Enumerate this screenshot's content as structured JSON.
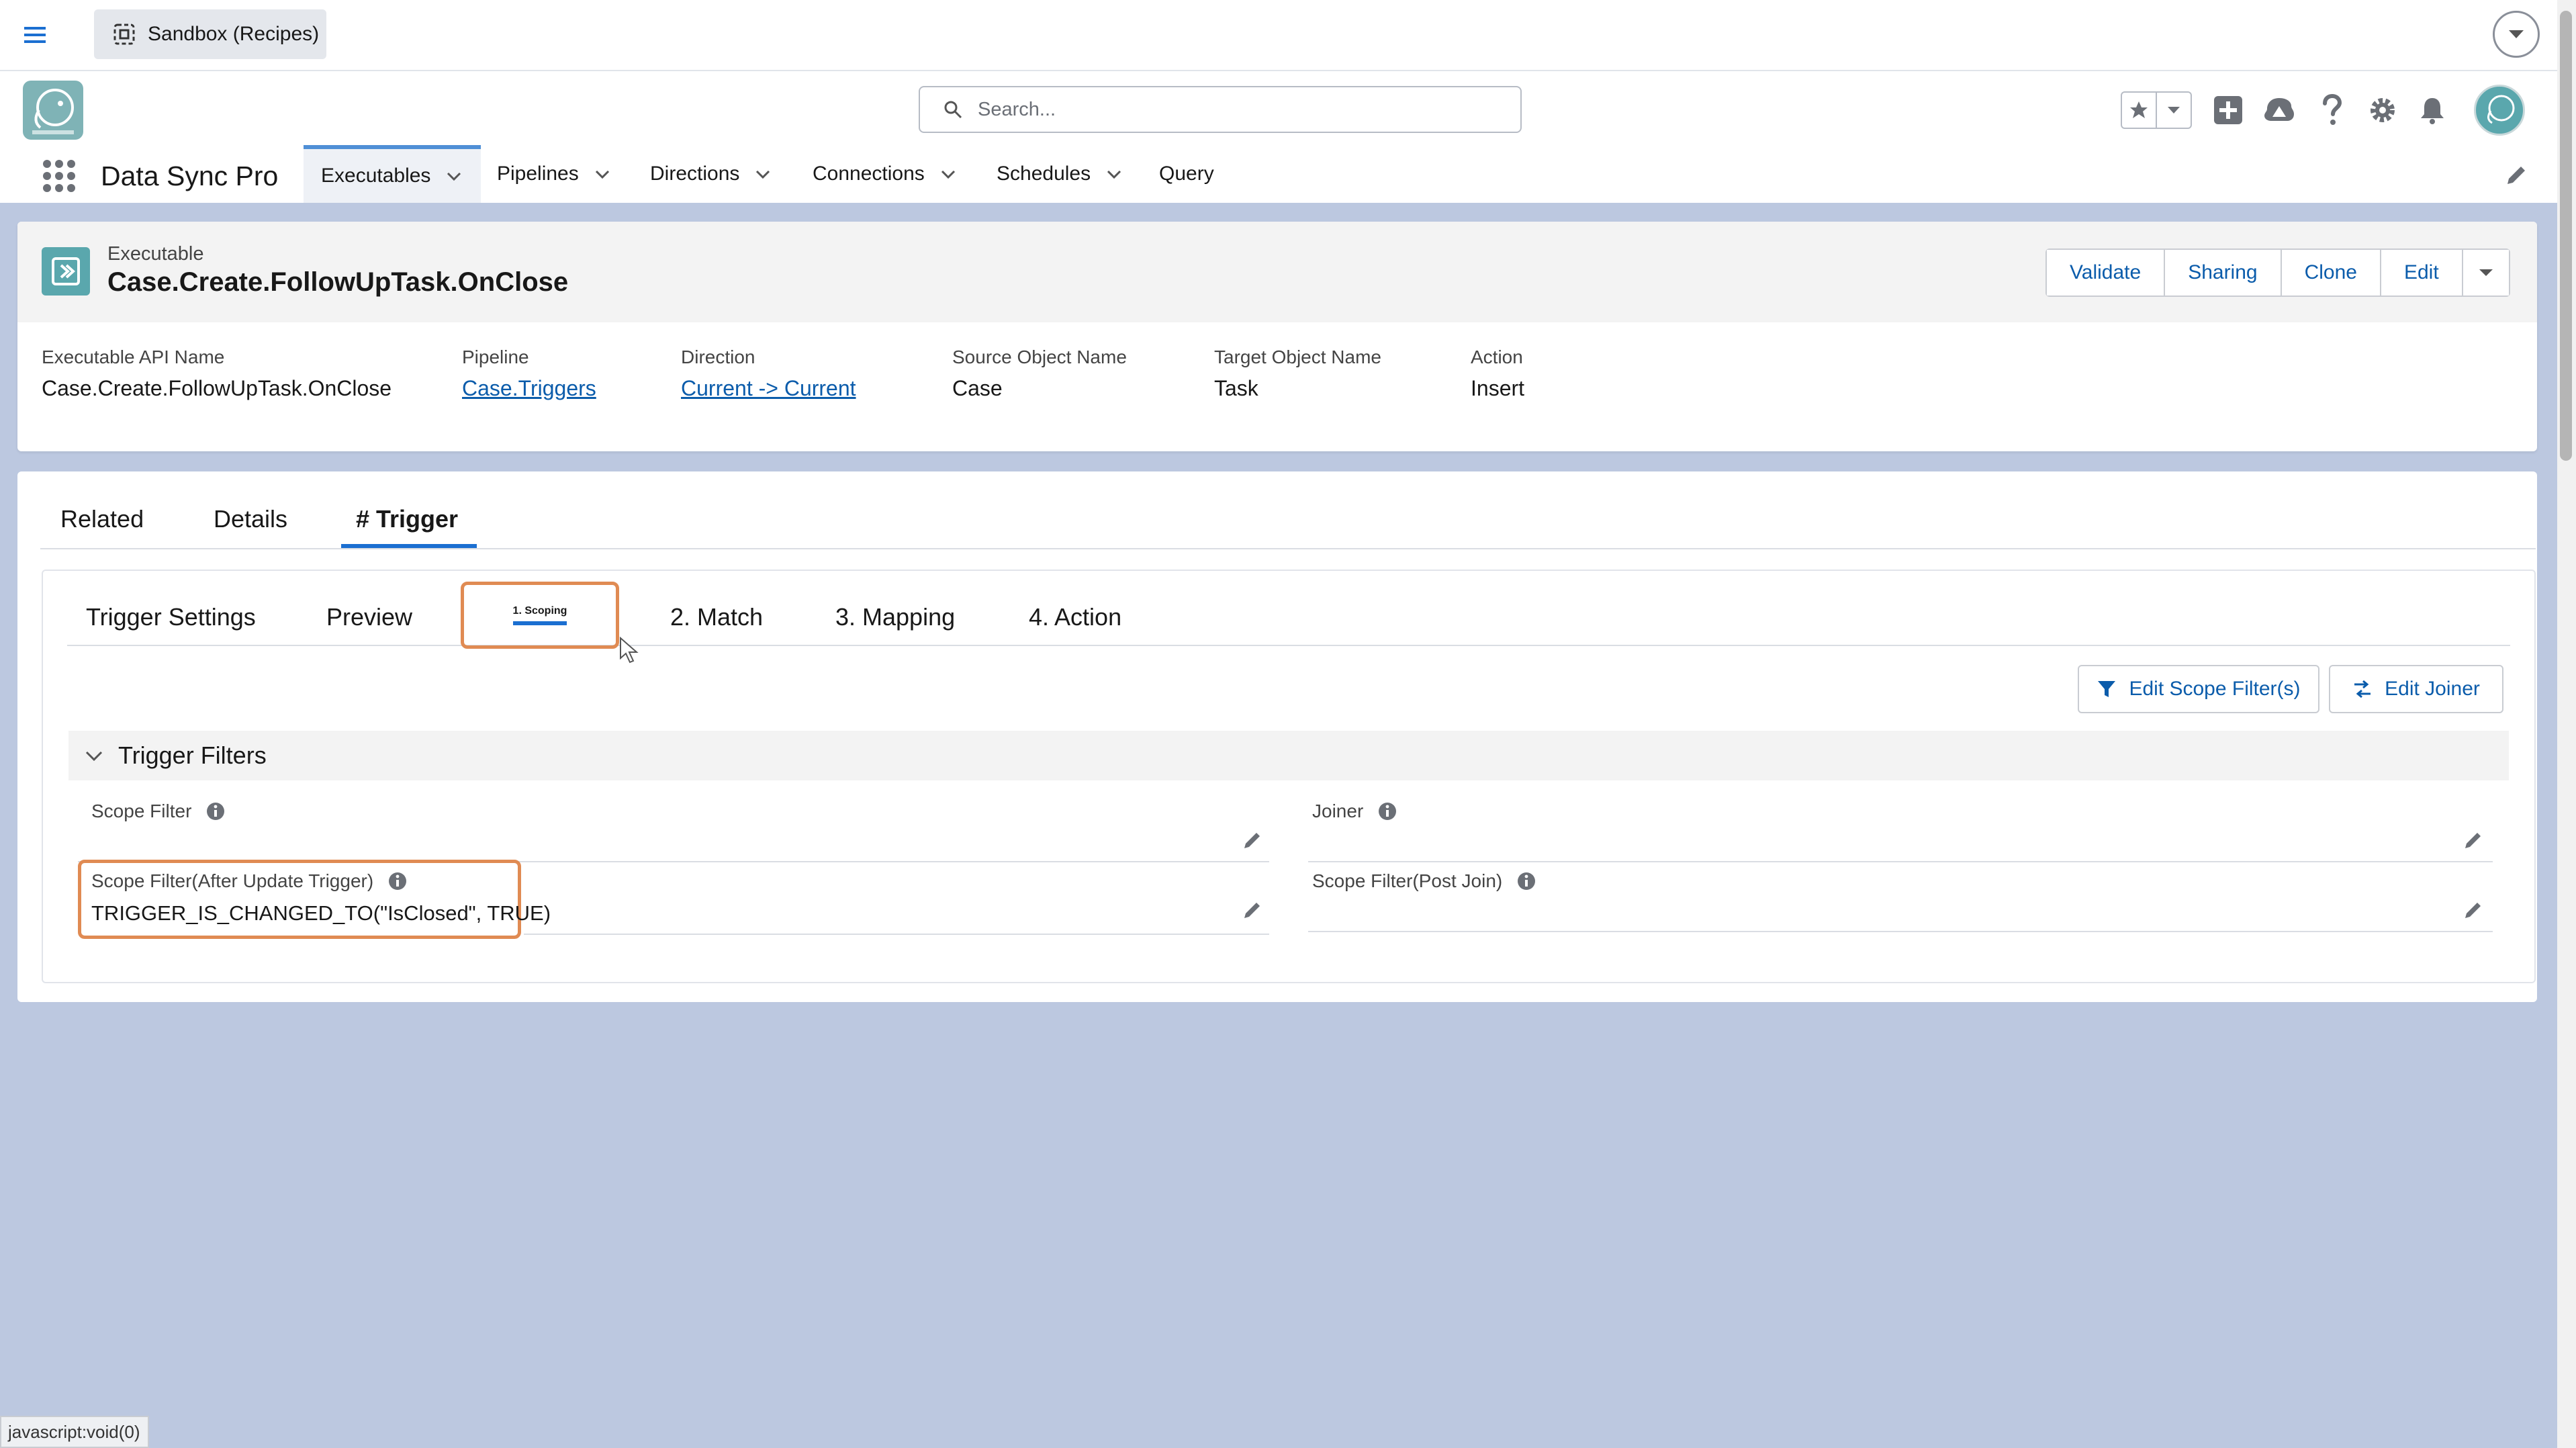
{
  "sandbox": {
    "label": "Sandbox (Recipes)"
  },
  "header": {
    "search_placeholder": "Search...",
    "app_name": "Data Sync Pro"
  },
  "nav": {
    "tabs": [
      {
        "label": "Executables",
        "active": true
      },
      {
        "label": "Pipelines"
      },
      {
        "label": "Directions"
      },
      {
        "label": "Connections"
      },
      {
        "label": "Schedules"
      },
      {
        "label": "Query"
      }
    ]
  },
  "record": {
    "type_label": "Executable",
    "title": "Case.Create.FollowUpTask.OnClose",
    "actions": [
      "Validate",
      "Sharing",
      "Clone",
      "Edit"
    ],
    "fields": [
      {
        "label": "Executable API Name",
        "value": "Case.Create.FollowUpTask.OnClose"
      },
      {
        "label": "Pipeline",
        "value": "Case.Triggers"
      },
      {
        "label": "Direction",
        "value": "Current -> Current"
      },
      {
        "label": "Source Object Name",
        "value": "Case"
      },
      {
        "label": "Target Object Name",
        "value": "Task"
      },
      {
        "label": "Action",
        "value": "Insert"
      }
    ]
  },
  "main_tabs": [
    "Related",
    "Details",
    "# Trigger"
  ],
  "sub_tabs": [
    "Trigger Settings",
    "Preview",
    "1. Scoping",
    "2. Match",
    "3. Mapping",
    "4. Action"
  ],
  "buttons": {
    "edit_scope": "Edit Scope Filter(s)",
    "edit_joiner": "Edit Joiner"
  },
  "section": {
    "title": "Trigger Filters",
    "fields": {
      "scope_filter": {
        "label": "Scope Filter",
        "value": ""
      },
      "joiner": {
        "label": "Joiner",
        "value": ""
      },
      "scope_after_update": {
        "label": "Scope Filter(After Update Trigger)",
        "value": "TRIGGER_IS_CHANGED_TO(\"IsClosed\", TRUE)"
      },
      "scope_post_join": {
        "label": "Scope Filter(Post Join)",
        "value": ""
      }
    }
  },
  "status_text": "javascript:void(0)",
  "colors": {
    "brand_blue": "#0b5cab",
    "highlight_orange": "#e08b53",
    "teal": "#5aa7ad",
    "page_bg": "#bcc8e0"
  }
}
